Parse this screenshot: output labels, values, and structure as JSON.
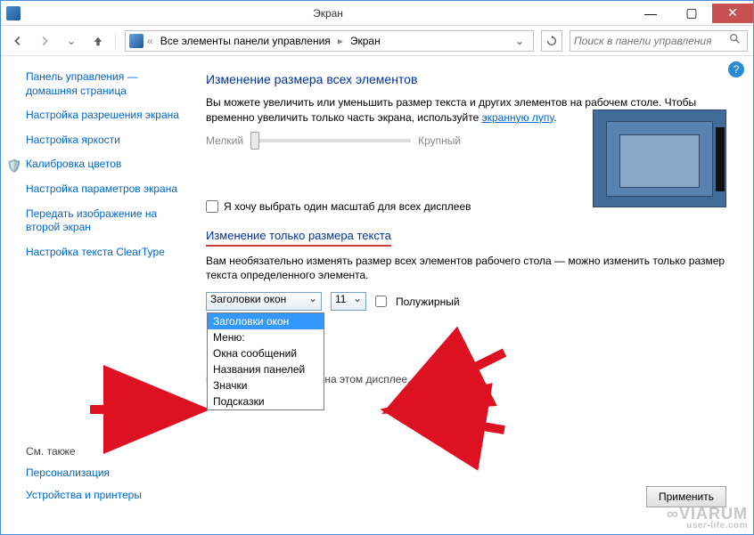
{
  "titlebar": {
    "title": "Экран"
  },
  "nav": {
    "breadcrumb_item1": "Все элементы панели управления",
    "breadcrumb_item2": "Экран",
    "search_placeholder": "Поиск в панели управления"
  },
  "sidebar": {
    "home": "Панель управления — домашняя страница",
    "links": [
      "Настройка разрешения экрана",
      "Настройка яркости",
      "Калибровка цветов",
      "Настройка параметров экрана",
      "Передать изображение на второй экран",
      "Настройка текста ClearType"
    ],
    "see_also_heading": "См. также",
    "see_also": [
      "Персонализация",
      "Устройства и принтеры"
    ]
  },
  "main": {
    "heading1": "Изменение размера всех элементов",
    "description": "Вы можете увеличить или уменьшить размер текста и других элементов на рабочем столе. Чтобы временно увеличить только часть экрана, используйте ",
    "magnifier_link": "экранную лупу",
    "slider_small": "Мелкий",
    "slider_large": "Крупный",
    "checkbox_label": "Я хочу выбрать один масштаб для всех дисплеев",
    "heading2": "Изменение только размера текста",
    "description2": "Вам необязательно изменять размер всех элементов рабочего стола — можно изменить только размер текста определенного элемента.",
    "element_combo_value": "Заголовки окон",
    "size_combo_value": "11",
    "bold_checkbox_label": "Полужирный",
    "dropdown_options": [
      "Заголовки окон",
      "Меню:",
      "Окна сообщений",
      "Названия панелей",
      "Значки",
      "Подсказки"
    ],
    "note": "нить размер элицентов на этом дисплее.",
    "apply_button": "Применить"
  },
  "watermark": {
    "line1": "∞VIARUM",
    "line2": "user-life.com"
  }
}
